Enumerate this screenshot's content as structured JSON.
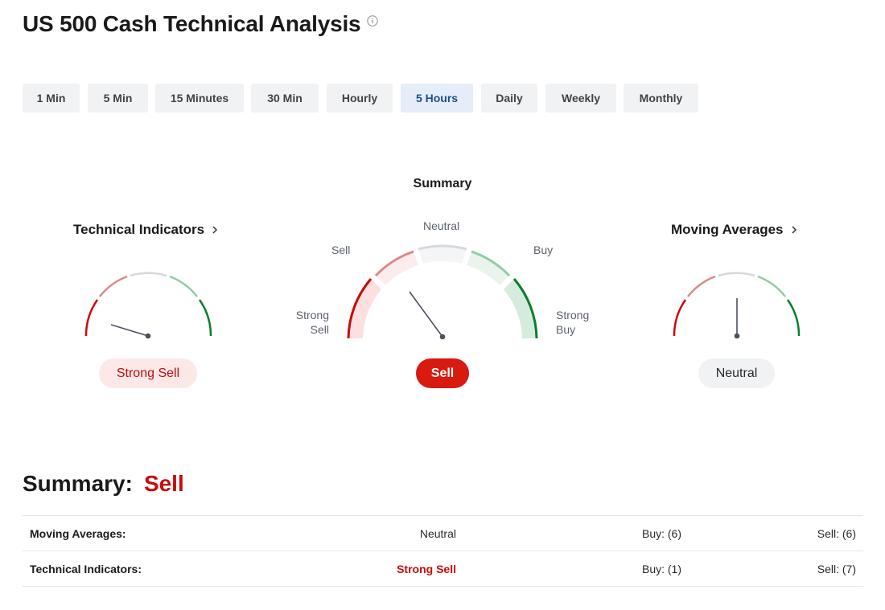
{
  "page": {
    "title": "US 500 Cash Technical Analysis"
  },
  "timeframes": [
    {
      "label": "1 Min",
      "active": false
    },
    {
      "label": "5 Min",
      "active": false
    },
    {
      "label": "15 Minutes",
      "active": false
    },
    {
      "label": "30 Min",
      "active": false
    },
    {
      "label": "Hourly",
      "active": false
    },
    {
      "label": "5 Hours",
      "active": true
    },
    {
      "label": "Daily",
      "active": false
    },
    {
      "label": "Weekly",
      "active": false
    },
    {
      "label": "Monthly",
      "active": false
    }
  ],
  "gauges": {
    "technical_indicators": {
      "title": "Technical Indicators",
      "value": "Strong Sell"
    },
    "summary": {
      "title": "Summary",
      "value": "Sell",
      "labels": {
        "strong_sell_1": "Strong",
        "strong_sell_2": "Sell",
        "sell": "Sell",
        "neutral": "Neutral",
        "buy": "Buy",
        "strong_buy_1": "Strong",
        "strong_buy_2": "Buy"
      }
    },
    "moving_averages": {
      "title": "Moving Averages",
      "value": "Neutral"
    }
  },
  "summary": {
    "label": "Summary:",
    "value": "Sell",
    "rows": [
      {
        "name": "Moving Averages:",
        "status": "Neutral",
        "buy": "Buy: (6)",
        "sell": "Sell: (6)"
      },
      {
        "name": "Technical Indicators:",
        "status": "Strong Sell",
        "buy": "Buy: (1)",
        "sell": "Sell: (7)"
      }
    ]
  },
  "colors": {
    "strong_sell": "#c90b0b",
    "sell": "#d98a8a",
    "neutral": "#d6d8dc",
    "buy": "#8fcca4",
    "strong_buy": "#0a7f2e",
    "active_tab_text": "#1a4f8f"
  }
}
